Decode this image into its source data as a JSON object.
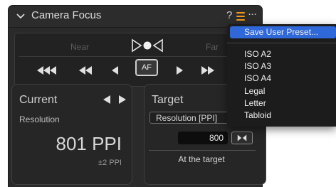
{
  "panel": {
    "title": "Camera Focus",
    "help_label": "?",
    "more_label": "···"
  },
  "focus": {
    "near_label": "Near",
    "far_label": "Far",
    "af_label": "AF"
  },
  "current": {
    "title": "Current",
    "metric_label": "Resolution",
    "value": "801 PPI",
    "tolerance": "±2 PPI"
  },
  "target": {
    "title": "Target",
    "select_value": "Resolution [PPI]",
    "input_value": "800",
    "status": "At the target"
  },
  "menu": {
    "items": [
      "Save User Preset...",
      "ISO A2",
      "ISO A3",
      "ISO A4",
      "Legal",
      "Letter",
      "Tabloid"
    ],
    "highlighted_index": 0
  },
  "colors": {
    "accent_menu_icon": "#f29a1d",
    "menu_highlight": "#2f68d8",
    "panel_bg": "#2a2a2a"
  }
}
